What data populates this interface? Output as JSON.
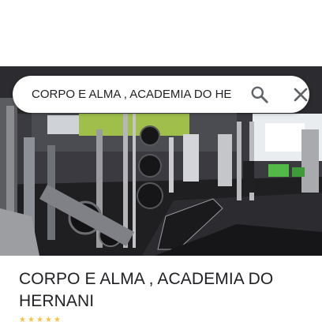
{
  "search": {
    "query": "CORPO E ALMA , ACADEMIA DO HE",
    "search_icon": "search-icon",
    "close_icon": "close-icon"
  },
  "place": {
    "photo_description_icon": "gym-photo",
    "title": "CORPO E ALMA , ACADEMIA DO HERNANI"
  },
  "colors": {
    "text": "#202124",
    "icon": "#5f6368",
    "star": "#f6c344"
  }
}
